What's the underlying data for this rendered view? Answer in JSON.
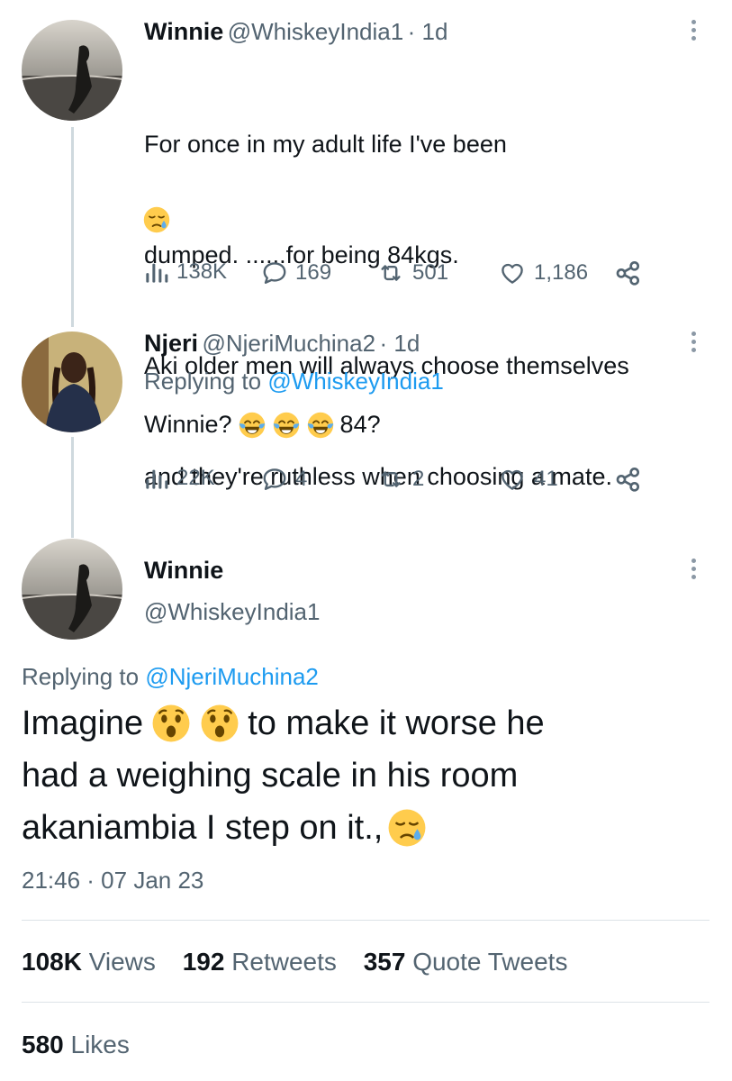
{
  "tweet1": {
    "name": "Winnie",
    "handle": "@WhiskeyIndia1",
    "time": "· 1d",
    "line1": "For once in my adult life I've been",
    "line2": "dumped. ......for being 84kgs.",
    "line3": "Aki older men will always choose themselves",
    "line4": "and they're ruthless when choosing a mate.",
    "emoji": "sad-relieved-face",
    "views": "138K",
    "replies": "169",
    "retweets": "501",
    "likes": "1,186"
  },
  "tweet2": {
    "name": "Njeri",
    "handle": "@NjeriMuchina2",
    "time": "· 1d",
    "replying_prefix": "Replying to",
    "replying_handle": "@WhiskeyIndia1",
    "text_before": "Winnie?",
    "text_after": "84?",
    "emojis": [
      "joy-face",
      "joy-face",
      "joy-face"
    ],
    "views": "22K",
    "replies": "4",
    "retweets": "2",
    "likes": "41"
  },
  "main_tweet": {
    "name": "Winnie",
    "handle": "@WhiskeyIndia1",
    "replying_prefix": "Replying to",
    "replying_handle": "@NjeriMuchina2",
    "line1_start": "Imagine",
    "line1_end": "to make it worse he",
    "line2": "had a weighing scale in his room",
    "line3": "akaniambia I step on it.,",
    "timestamp": "21:46 · 07 Jan 23",
    "stats": {
      "views_num": "108K",
      "views_label": "Views",
      "retweets_num": "192",
      "retweets_label": "Retweets",
      "quotes_num": "357",
      "quotes_label": "Quote Tweets",
      "likes_num": "580",
      "likes_label": "Likes"
    }
  },
  "colors": {
    "accent": "#1d9bf0",
    "secondary_text": "#536471",
    "divider": "#dde3e7"
  }
}
